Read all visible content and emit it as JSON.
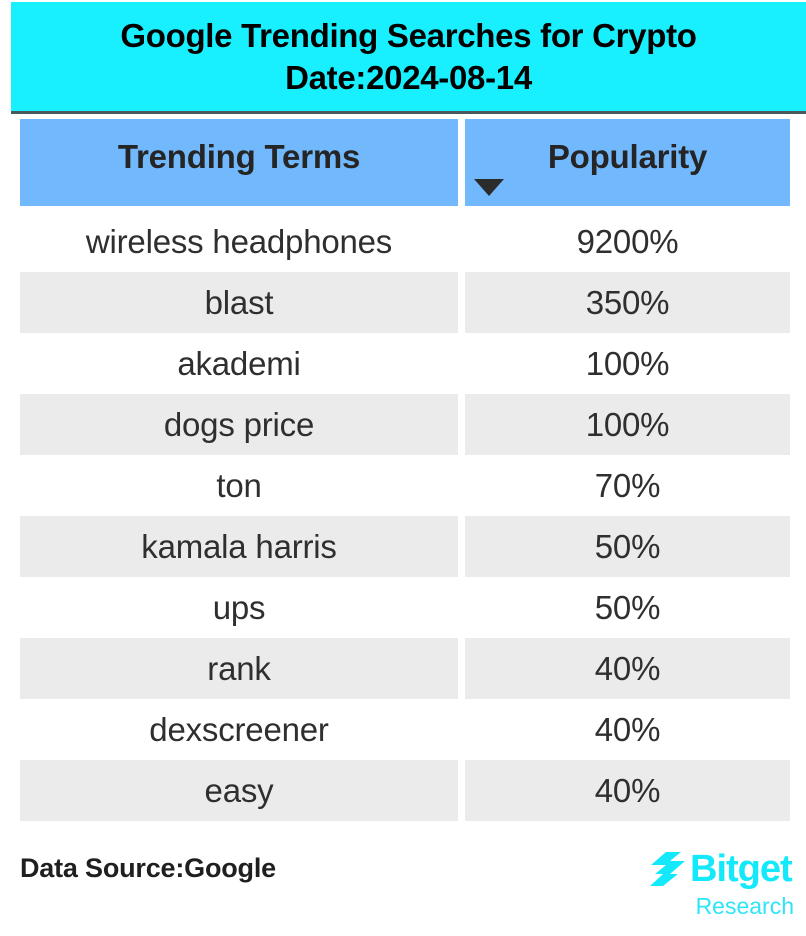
{
  "banner": {
    "title_line1": "Google Trending Searches for Crypto",
    "title_line2": "Date:2024-08-14",
    "background_color": "#19f0ff",
    "text_color": "#000000"
  },
  "table": {
    "header": {
      "term_label": "Trending Terms",
      "popularity_label": "Popularity",
      "sort_icon": "triangle-down-icon",
      "sort_direction": "descending",
      "background_color": "#72b8fc"
    },
    "row_colors": {
      "odd": "#ffffff",
      "even": "#ebebeb"
    },
    "rows": [
      {
        "term": "wireless headphones",
        "popularity": "9200%"
      },
      {
        "term": "blast",
        "popularity": "350%"
      },
      {
        "term": "akademi",
        "popularity": "100%"
      },
      {
        "term": "dogs price",
        "popularity": "100%"
      },
      {
        "term": "ton",
        "popularity": "70%"
      },
      {
        "term": "kamala harris",
        "popularity": "50%"
      },
      {
        "term": "ups",
        "popularity": "50%"
      },
      {
        "term": "rank",
        "popularity": "40%"
      },
      {
        "term": "dexscreener",
        "popularity": "40%"
      },
      {
        "term": "easy",
        "popularity": "40%"
      }
    ]
  },
  "footer": {
    "data_source": "Data Source:Google",
    "logo_name": "Bitget",
    "logo_subtitle": "Research",
    "logo_color": "#14e8fb"
  },
  "chart_data": {
    "type": "table",
    "title": "Google Trending Searches for Crypto Date:2024-08-14",
    "columns": [
      "Trending Terms",
      "Popularity"
    ],
    "categories": [
      "wireless headphones",
      "blast",
      "akademi",
      "dogs price",
      "ton",
      "kamala harris",
      "ups",
      "rank",
      "dexscreener",
      "easy"
    ],
    "values": [
      9200,
      350,
      100,
      100,
      70,
      50,
      50,
      40,
      40,
      40
    ],
    "value_labels": [
      "9200%",
      "350%",
      "100%",
      "100%",
      "70%",
      "50%",
      "50%",
      "40%",
      "40%",
      "40%"
    ],
    "unit": "%",
    "sorted_by": "Popularity",
    "sort_order": "descending",
    "xlabel": "Trending Terms",
    "ylabel": "Popularity",
    "source": "Google"
  }
}
